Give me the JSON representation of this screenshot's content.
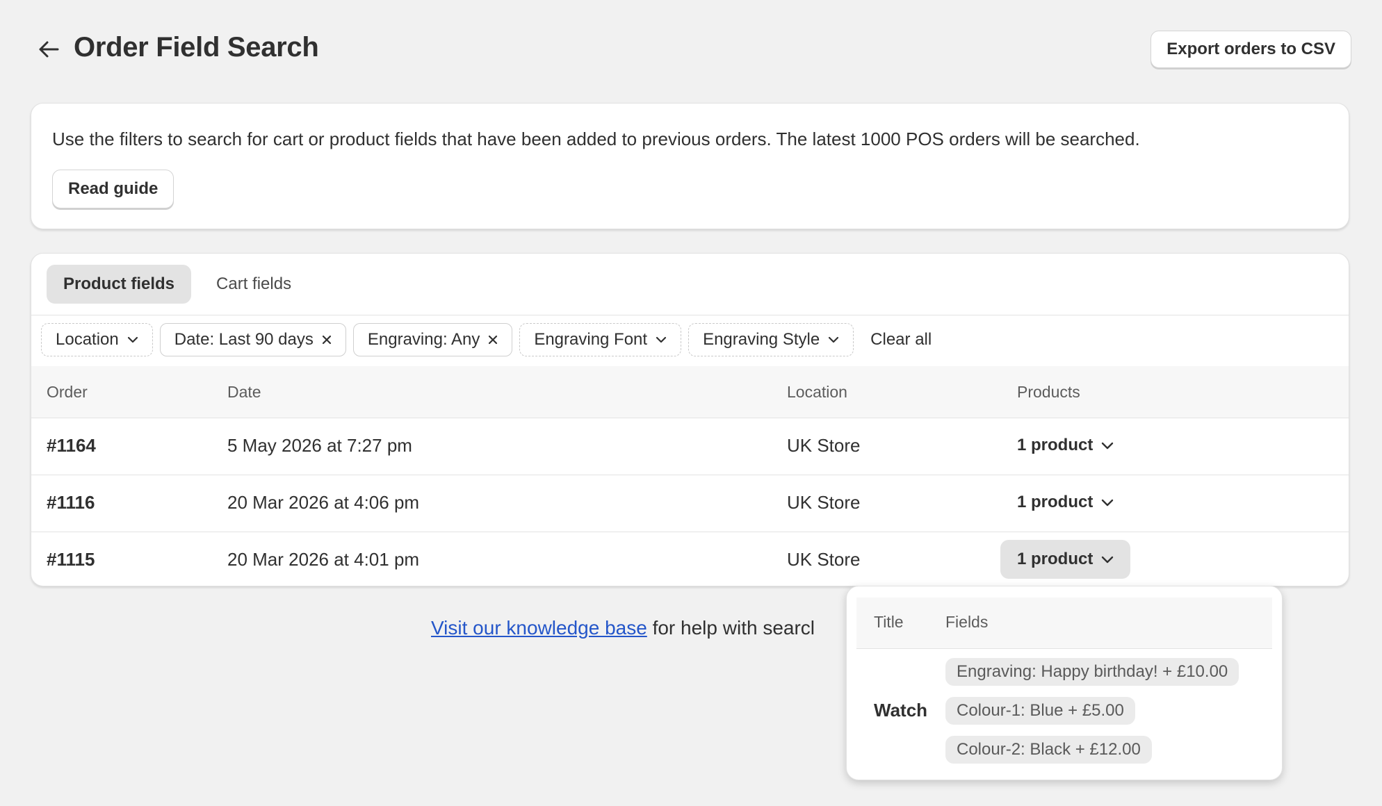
{
  "header": {
    "title": "Order Field Search",
    "export_label": "Export orders to CSV"
  },
  "info": {
    "text": "Use the filters to search for cart or product fields that have been added to previous orders. The latest 1000 POS orders will be searched.",
    "guide_label": "Read guide"
  },
  "tabs": [
    {
      "label": "Product fields",
      "active": true
    },
    {
      "label": "Cart fields",
      "active": false
    }
  ],
  "filters": {
    "location": "Location",
    "date": "Date: Last 90 days",
    "engraving": "Engraving: Any",
    "engraving_font": "Engraving Font",
    "engraving_style": "Engraving Style",
    "clear_all": "Clear all"
  },
  "table": {
    "headers": {
      "order": "Order",
      "date": "Date",
      "location": "Location",
      "products": "Products"
    },
    "rows": [
      {
        "order": "#1164",
        "date": "5 May 2026 at 7:27 pm",
        "location": "UK Store",
        "products": "1 product"
      },
      {
        "order": "#1116",
        "date": "20 Mar 2026 at 4:06 pm",
        "location": "UK Store",
        "products": "1 product"
      },
      {
        "order": "#1115",
        "date": "20 Mar 2026 at 4:01 pm",
        "location": "UK Store",
        "products": "1 product"
      }
    ]
  },
  "help": {
    "link": "Visit our knowledge base",
    "text": " for help with searcl"
  },
  "popover": {
    "headers": {
      "title": "Title",
      "fields": "Fields"
    },
    "product": "Watch",
    "fields": [
      "Engraving: Happy birthday! + £10.00",
      "Colour-1: Blue + £5.00",
      "Colour-2: Black + £12.00"
    ]
  }
}
